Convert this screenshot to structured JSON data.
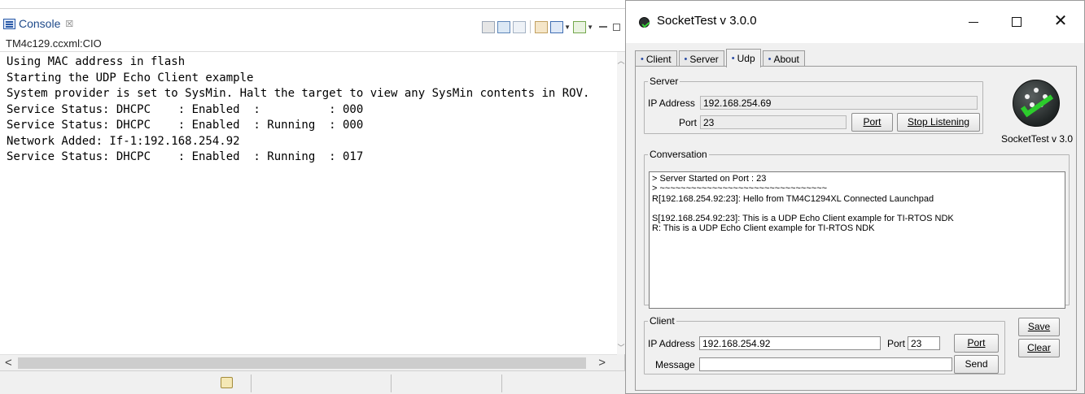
{
  "console": {
    "tab_label": "Console",
    "tab_close": "☒",
    "subtitle": "TM4c129.ccxml:CIO",
    "lines": [
      "Using MAC address in flash",
      "Starting the UDP Echo Client example",
      "System provider is set to SysMin. Halt the target to view any SysMin contents in ROV.",
      "Service Status: DHCPC    : Enabled  :          : 000",
      "Service Status: DHCPC    : Enabled  : Running  : 000",
      "Network Added: If-1:192.168.254.92",
      "Service Status: DHCPC    : Enabled  : Running  : 017"
    ],
    "toolbar_icons": [
      "clear-console-icon",
      "scroll-lock-icon",
      "word-wrap-icon",
      "pin-console-icon",
      "display-selected-console-icon",
      "open-console-icon",
      "minimize-icon",
      "maximize-icon"
    ]
  },
  "sockettest": {
    "window_title": "SocketTest v 3.0.0",
    "tabs": [
      {
        "label": "Client"
      },
      {
        "label": "Server"
      },
      {
        "label": "Udp"
      },
      {
        "label": "About"
      }
    ],
    "active_tab": "Udp",
    "server": {
      "legend": "Server",
      "ip_label": "IP Address",
      "ip_value": "192.168.254.69",
      "port_label": "Port",
      "port_value": "23",
      "port_button": "Port",
      "stop_button": "Stop Listening"
    },
    "logo_caption": "SocketTest v 3.0",
    "conversation": {
      "legend": "Conversation",
      "lines": [
        "> Server Started on Port : 23",
        "> ~~~~~~~~~~~~~~~~~~~~~~~~~~~~~~~~",
        "R[192.168.254.92:23]: Hello from TM4C1294XL Connected Launchpad",
        "",
        "S[192.168.254.92:23]: This is a UDP Echo Client example for TI-RTOS NDK",
        "R: This is a UDP Echo Client example for TI-RTOS NDK"
      ]
    },
    "client": {
      "legend": "Client",
      "ip_label": "IP Address",
      "ip_value": "192.168.254.92",
      "port_label": "Port",
      "port_value": "23",
      "port_button": "Port",
      "message_label": "Message",
      "message_value": "",
      "send_button": "Send"
    },
    "save_button": "Save",
    "clear_button": "Clear"
  }
}
